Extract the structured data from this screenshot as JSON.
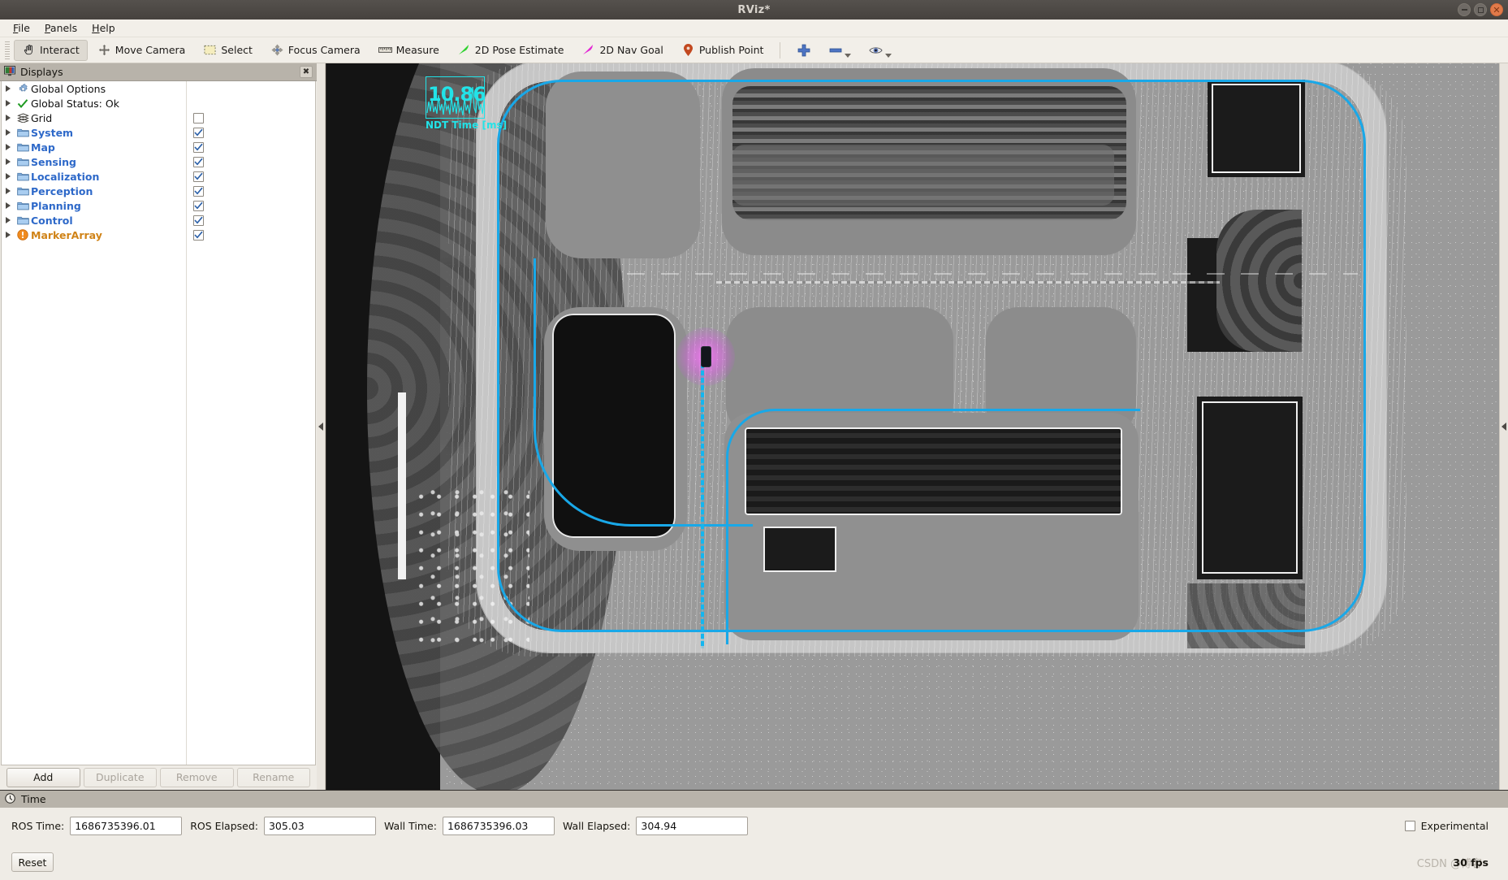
{
  "window": {
    "title": "RViz*",
    "controls": {
      "minimize": "minimize-button",
      "maximize": "maximize-button",
      "close": "close-button"
    }
  },
  "menubar": {
    "items": [
      {
        "label": "File",
        "mnemonic": "F"
      },
      {
        "label": "Panels",
        "mnemonic": "P"
      },
      {
        "label": "Help",
        "mnemonic": "H"
      }
    ]
  },
  "toolbar": {
    "tools": [
      {
        "label": "Interact",
        "icon": "hand-icon",
        "active": true
      },
      {
        "label": "Move Camera",
        "icon": "move-camera-icon",
        "active": false
      },
      {
        "label": "Select",
        "icon": "select-icon",
        "active": false
      },
      {
        "label": "Focus Camera",
        "icon": "focus-camera-icon",
        "active": false
      },
      {
        "label": "Measure",
        "icon": "ruler-icon",
        "active": false
      },
      {
        "label": "2D Pose Estimate",
        "icon": "green-arrow-icon",
        "active": false
      },
      {
        "label": "2D Nav Goal",
        "icon": "magenta-arrow-icon",
        "active": false
      },
      {
        "label": "Publish Point",
        "icon": "map-pin-icon",
        "active": false
      }
    ],
    "extras": [
      {
        "icon": "plus-icon",
        "name": "add-tool-button",
        "caret": false
      },
      {
        "icon": "minus-icon",
        "name": "remove-tool-button",
        "caret": true
      },
      {
        "icon": "eye-icon",
        "name": "view-tool-button",
        "caret": true
      }
    ]
  },
  "displays_panel": {
    "title": "Displays",
    "icon": "displays-icon",
    "close_label": "✖",
    "items": [
      {
        "label": "Global Options",
        "icon": "gear-icon",
        "style": "plain",
        "checkbox": "none"
      },
      {
        "label": "Global Status: Ok",
        "icon": "check-icon",
        "style": "plain",
        "checkbox": "none"
      },
      {
        "label": "Grid",
        "icon": "grid-icon",
        "style": "plain",
        "checkbox": "unchecked"
      },
      {
        "label": "System",
        "icon": "folder-icon",
        "style": "folder",
        "checkbox": "checked"
      },
      {
        "label": "Map",
        "icon": "folder-icon",
        "style": "folder",
        "checkbox": "checked"
      },
      {
        "label": "Sensing",
        "icon": "folder-icon",
        "style": "folder",
        "checkbox": "checked"
      },
      {
        "label": "Localization",
        "icon": "folder-icon",
        "style": "folder",
        "checkbox": "checked"
      },
      {
        "label": "Perception",
        "icon": "folder-icon",
        "style": "folder",
        "checkbox": "checked"
      },
      {
        "label": "Planning",
        "icon": "folder-icon",
        "style": "folder",
        "checkbox": "checked"
      },
      {
        "label": "Control",
        "icon": "folder-icon",
        "style": "folder",
        "checkbox": "checked"
      },
      {
        "label": "MarkerArray",
        "icon": "warning-icon",
        "style": "warn",
        "checkbox": "checked"
      }
    ],
    "buttons": [
      {
        "label": "Add",
        "enabled": true
      },
      {
        "label": "Duplicate",
        "enabled": false
      },
      {
        "label": "Remove",
        "enabled": false
      },
      {
        "label": "Rename",
        "enabled": false
      }
    ]
  },
  "view3d": {
    "overlay": {
      "ndt_value": "10.86",
      "ndt_label": "NDT Time [ms]",
      "color": "#22e3e8"
    },
    "ego_vehicle": {
      "name": "ego-vehicle-marker",
      "glow_color": "#ff6eff"
    },
    "route_color": "#19a8e8",
    "collapse_left": "◀",
    "collapse_right": "◀"
  },
  "time_panel": {
    "title": "Time",
    "icon": "clock-icon",
    "fields": [
      {
        "label": "ROS Time:",
        "value": "1686735396.01",
        "name": "ros-time-input"
      },
      {
        "label": "ROS Elapsed:",
        "value": "305.03",
        "name": "ros-elapsed-input"
      },
      {
        "label": "Wall Time:",
        "value": "1686735396.03",
        "name": "wall-time-input"
      },
      {
        "label": "Wall Elapsed:",
        "value": "304.94",
        "name": "wall-elapsed-input"
      }
    ],
    "experimental": {
      "label": "Experimental",
      "checked": false
    }
  },
  "footer": {
    "reset_label": "Reset",
    "fps": "30 fps",
    "watermark": "CSDN @博客"
  }
}
